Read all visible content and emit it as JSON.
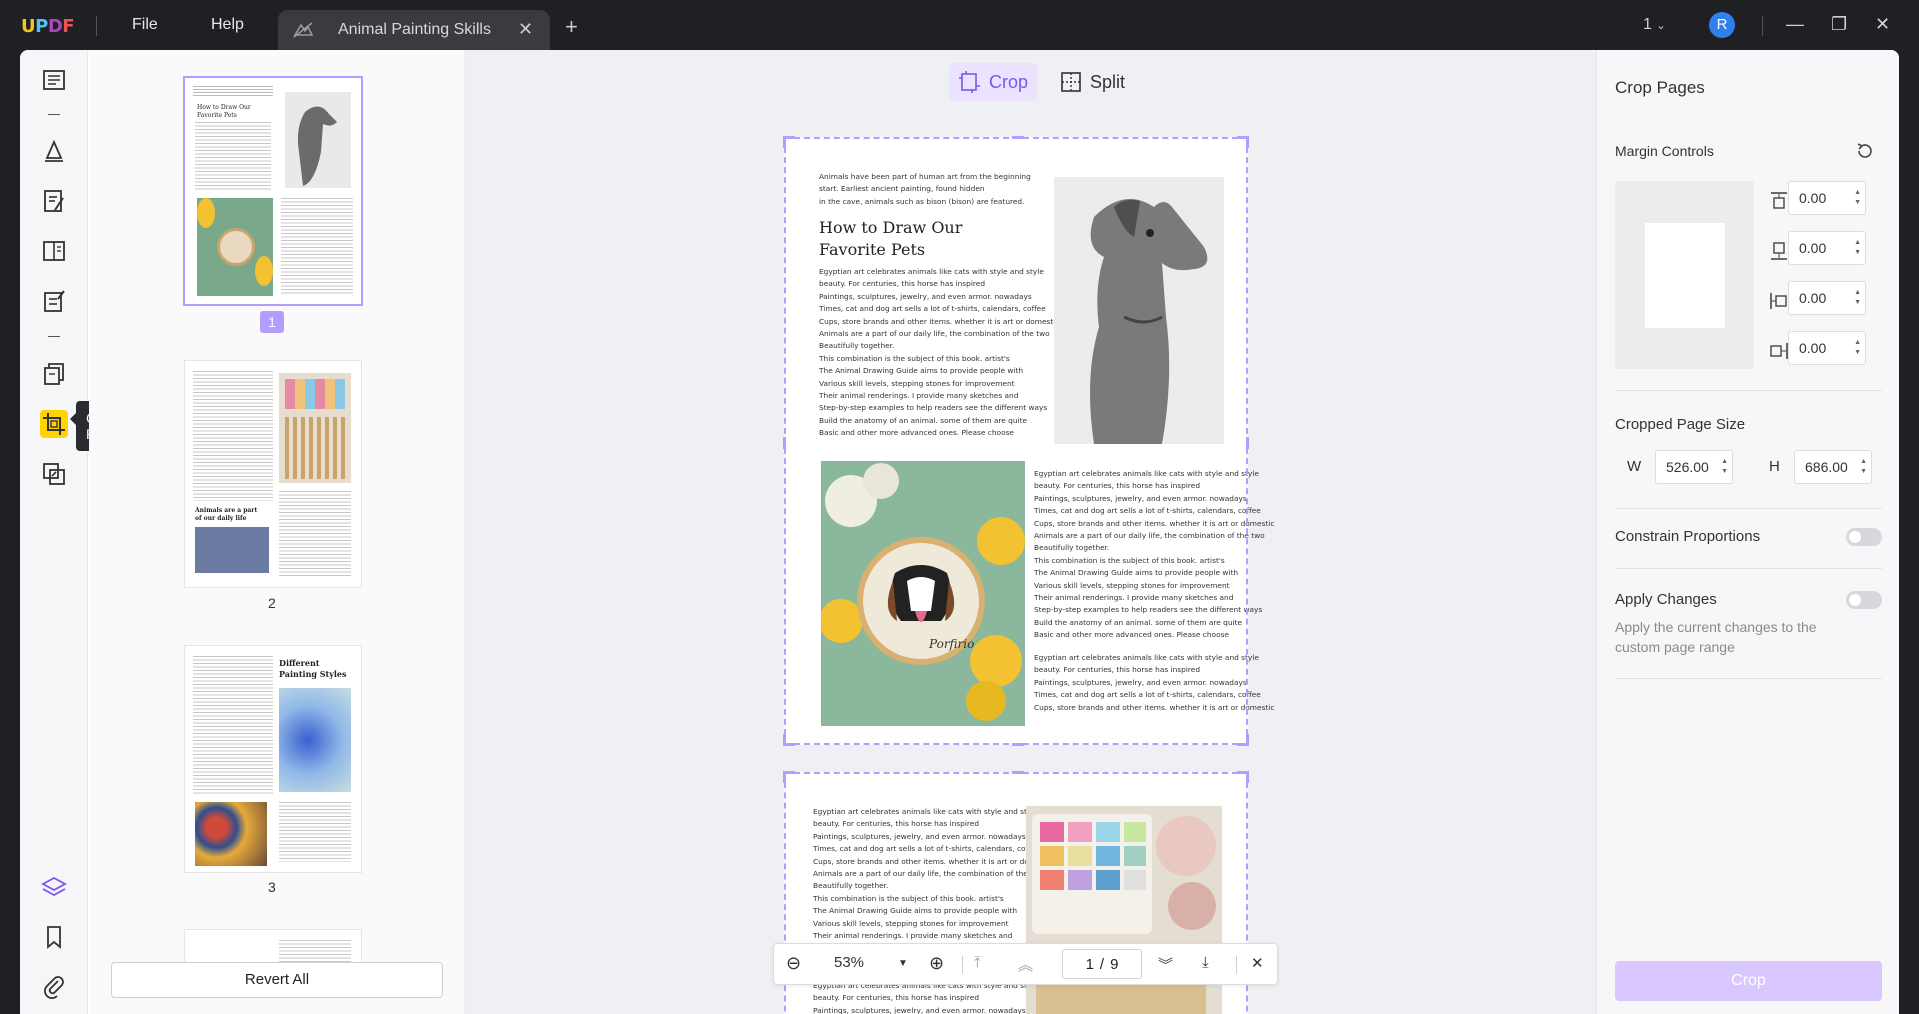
{
  "titlebar": {
    "logo": "UPDF",
    "menu": [
      "File",
      "Help"
    ],
    "tab_title": "Animal Painting Skills",
    "page_count": "1",
    "avatar_initial": "R"
  },
  "toolbar": {
    "tooltip": "Crop Pages",
    "icons": [
      "reader-icon",
      "comment-icon",
      "edit-pdf-icon",
      "organize-pages-icon",
      "form-icon",
      "page-tools-icon",
      "crop-pages-icon",
      "compare-icon",
      "layers-icon",
      "bookmark-icon",
      "attachment-icon"
    ]
  },
  "thumbnails": {
    "pages": [
      {
        "number": "1",
        "heading": "How to Draw Our Favorite Pets"
      },
      {
        "number": "2",
        "heading": "Animals are a part of our daily life"
      },
      {
        "number": "3",
        "heading": "Different Painting Styles"
      }
    ],
    "revert_label": "Revert All"
  },
  "canvas": {
    "modes": [
      "Crop",
      "Split"
    ],
    "page1": {
      "intro": "Animals have been part of human art from the beginning\nstart. Earliest ancient painting, found hidden\nin the cave, animals such as bison (bison) are featured.",
      "title": "How to Draw Our\nFavorite Pets",
      "col1": "Egyptian art celebrates animals like cats with style and style\nbeauty. For centuries, this horse has inspired\nPaintings, sculptures, jewelry, and even armor. nowadays\nTimes, cat and dog art sells a lot of t-shirts, calendars, coffee\nCups, store brands and other items. whether it is art or domestic\nAnimals are a part of our daily life, the combination of the two\nBeautifully together.\nThis combination is the subject of this book. artist's\nThe Animal Drawing Guide aims to provide people with\nVarious skill levels, stepping stones for improvement\nTheir animal renderings. I provide many sketches and\nStep-by-step examples to help readers see the different ways\nBuild the anatomy of an animal. some of them are quite\nBasic and other more advanced ones. Please choose",
      "col2": "Egyptian art celebrates animals like cats with style and style\nbeauty. For centuries, this horse has inspired\nPaintings, sculptures, jewelry, and even armor. nowadays\nTimes, cat and dog art sells a lot of t-shirts, calendars, coffee\nCups, store brands and other items. whether it is art or domestic\nAnimals are a part of our daily life, the combination of the two\nBeautifully together.\nThis combination is the subject of this book. artist's\nThe Animal Drawing Guide aims to provide people with\nVarious skill levels, stepping stones for improvement\nTheir animal renderings. I provide many sketches and\nStep-by-step examples to help readers see the different ways\nBuild the anatomy of an animal. some of them are quite\nBasic and other more advanced ones. Please choose",
      "col3": "Egyptian art celebrates animals like cats with style and style\nbeauty. For centuries, this horse has inspired\nPaintings, sculptures, jewelry, and even armor. nowadays\nTimes, cat and dog art sells a lot of t-shirts, calendars, coffee\nCups, store brands and other items. whether it is art or domestic",
      "hoop_text": "Porfirio"
    },
    "page2": {
      "col1": "Egyptian art celebrates animals like cats with style and style\nbeauty. For centuries, this horse has inspired\nPaintings, sculptures, jewelry, and even armor. nowadays\nTimes, cat and dog art sells a lot of t-shirts, calendars, coffee\nCups, store brands and other items. whether it is art or domestic\nAnimals are a part of our daily life, the combination of the two\nBeautifully together.\nThis combination is the subject of this book. artist's\nThe Animal Drawing Guide aims to provide people with\nVarious skill levels, stepping stones for improvement\nTheir animal renderings. I provide many sketches and\nStep-by-step examples to help readers see the different ways\nBuild the anatomy of an animal. some of them are quite\nBasic and other more advanced ones. Please choose\nEgyptian art celebrates animals like cats with style and style\nbeauty. For centuries, this horse has inspired\nPaintings, sculptures, jewelry, and even armor. nowadays"
    },
    "nav": {
      "zoom": "53%",
      "current_page": "1",
      "separator": "/",
      "total_pages": "9"
    }
  },
  "panel": {
    "title": "Crop Pages",
    "margin_controls_label": "Margin Controls",
    "margins": {
      "top": "0.00",
      "bottom": "0.00",
      "left": "0.00",
      "right": "0.00"
    },
    "cropped_size_label": "Cropped Page Size",
    "width_label": "W",
    "width_value": "526.00",
    "height_label": "H",
    "height_value": "686.00",
    "constrain_label": "Constrain Proportions",
    "constrain_on": false,
    "apply_label": "Apply Changes",
    "apply_on": false,
    "apply_desc": "Apply the current changes to the custom page range",
    "crop_button": "Crop"
  },
  "colors": {
    "accent": "#b59cff",
    "accent_text": "#7b55f0",
    "tool_active": "#ffd400",
    "avatar": "#2f80ed",
    "titlebar": "#1f2024"
  }
}
